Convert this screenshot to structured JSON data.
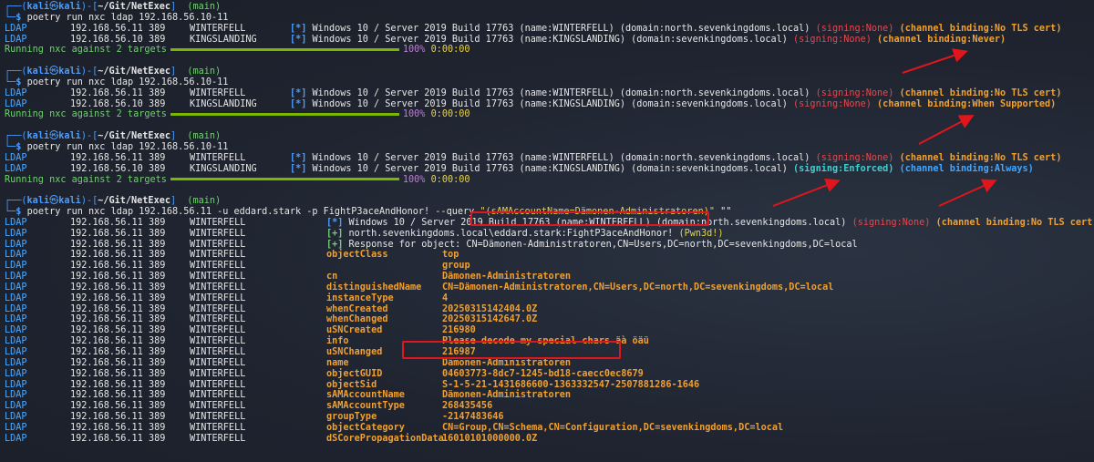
{
  "prompt": {
    "user": "kali",
    "host": "kali",
    "path": "~/Git/NetExec",
    "branch": "(main)",
    "symbol": "$"
  },
  "blocks": [
    {
      "command": "poetry run nxc ldap 192.168.56.10-11",
      "rows": [
        {
          "proto": "LDAP",
          "ip": "192.168.56.11",
          "port": "389",
          "host": "WINTERFELL",
          "info": "Windows 10 / Server 2019 Build 17763 (name:WINTERFELL) (domain:north.sevenkingdoms.local)",
          "signing": "(signing:None)",
          "binding": "(channel binding:No TLS cert)"
        },
        {
          "proto": "LDAP",
          "ip": "192.168.56.10",
          "port": "389",
          "host": "KINGSLANDING",
          "info": "Windows 10 / Server 2019 Build 17763 (name:KINGSLANDING) (domain:sevenkingdoms.local)",
          "signing": "(signing:None)",
          "binding": "(channel binding:Never)"
        }
      ],
      "progress": "Running nxc against 2 targets",
      "percent": "100%",
      "time": "0:00:00"
    },
    {
      "command": "poetry run nxc ldap 192.168.56.10-11",
      "rows": [
        {
          "proto": "LDAP",
          "ip": "192.168.56.11",
          "port": "389",
          "host": "WINTERFELL",
          "info": "Windows 10 / Server 2019 Build 17763 (name:WINTERFELL) (domain:north.sevenkingdoms.local)",
          "signing": "(signing:None)",
          "binding": "(channel binding:No TLS cert)"
        },
        {
          "proto": "LDAP",
          "ip": "192.168.56.10",
          "port": "389",
          "host": "KINGSLANDING",
          "info": "Windows 10 / Server 2019 Build 17763 (name:KINGSLANDING) (domain:sevenkingdoms.local)",
          "signing": "(signing:None)",
          "binding": "(channel binding:When Supported)"
        }
      ],
      "progress": "Running nxc against 2 targets",
      "percent": "100%",
      "time": "0:00:00"
    },
    {
      "command": "poetry run nxc ldap 192.168.56.10-11",
      "rows": [
        {
          "proto": "LDAP",
          "ip": "192.168.56.11",
          "port": "389",
          "host": "WINTERFELL",
          "info": "Windows 10 / Server 2019 Build 17763 (name:WINTERFELL) (domain:north.sevenkingdoms.local)",
          "signing": "(signing:None)",
          "binding": "(channel binding:No TLS cert)"
        },
        {
          "proto": "LDAP",
          "ip": "192.168.56.10",
          "port": "389",
          "host": "KINGSLANDING",
          "info": "Windows 10 / Server 2019 Build 17763 (name:KINGSLANDING) (domain:sevenkingdoms.local)",
          "signing": "(signing:Enforced)",
          "binding": "(channel binding:Always)"
        }
      ],
      "progress": "Running nxc against 2 targets",
      "percent": "100%",
      "time": "0:00:00"
    }
  ],
  "query_block": {
    "command_prefix": "poetry run nxc ldap 192.168.56.11 -u eddard.stark -p FightP3aceAndHonor! --query",
    "query_filter": "\"(sAMAccountName=Dämonen-Administratoren)\"",
    "query_suffix": " \"\"",
    "proto": "LDAP",
    "ip": "192.168.56.11",
    "port": "389",
    "host": "WINTERFELL",
    "line1_info": "Windows 10 / Server 2019 Build 17763 (name:WINTERFELL) (domain:north.sevenkingdoms.local)",
    "line1_signing": "(signing:None)",
    "line1_binding": "(channel binding:No TLS cert)",
    "line2_text": "north.sevenkingdoms.local\\eddard.stark:FightP3aceAndHonor!",
    "line2_pwn": "(Pwn3d!)",
    "line3_text": "Response for object: CN=Dämonen-Administratoren,CN=Users,DC=north,DC=sevenkingdoms,DC=local",
    "attributes": [
      {
        "key": "objectClass",
        "value": "top"
      },
      {
        "key": "",
        "value": "group"
      },
      {
        "key": "cn",
        "value": "Dämonen-Administratoren"
      },
      {
        "key": "distinguishedName",
        "value": "CN=Dämonen-Administratoren,CN=Users,DC=north,DC=sevenkingdoms,DC=local"
      },
      {
        "key": "instanceType",
        "value": "4"
      },
      {
        "key": "whenCreated",
        "value": "20250315142404.0Z"
      },
      {
        "key": "whenChanged",
        "value": "20250315142647.0Z"
      },
      {
        "key": "uSNCreated",
        "value": "216980"
      },
      {
        "key": "info",
        "value": "Please decode my special chars äà öäü"
      },
      {
        "key": "uSNChanged",
        "value": "216987"
      },
      {
        "key": "name",
        "value": "Dämonen-Administratoren"
      },
      {
        "key": "objectGUID",
        "value": "04603773-8dc7-1245-bd18-caecc0ec8679"
      },
      {
        "key": "objectSid",
        "value": "S-1-5-21-1431686600-1363332547-2507881286-1646"
      },
      {
        "key": "sAMAccountName",
        "value": "Dämonen-Administratoren"
      },
      {
        "key": "sAMAccountType",
        "value": "268435456"
      },
      {
        "key": "groupType",
        "value": "-2147483646"
      },
      {
        "key": "objectCategory",
        "value": "CN=Group,CN=Schema,CN=Configuration,DC=sevenkingdoms,DC=local"
      },
      {
        "key": "dSCorePropagationData",
        "value": "16010101000000.0Z"
      }
    ]
  },
  "markers": {
    "star": "[*]",
    "plus": "[+]",
    "annotation_color": "#e0161c"
  }
}
